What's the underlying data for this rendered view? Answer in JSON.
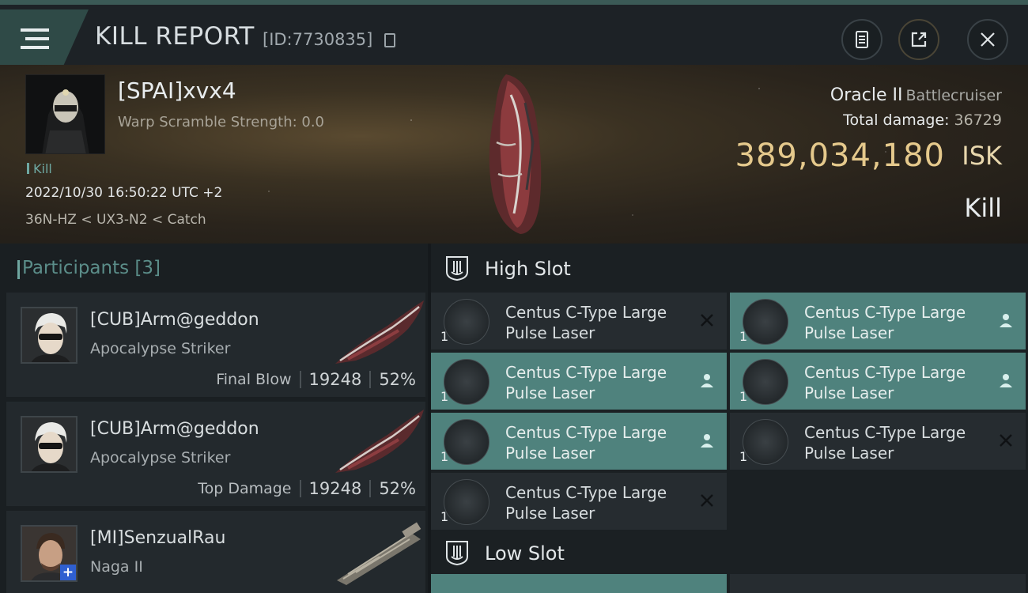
{
  "header": {
    "title": "KILL REPORT",
    "kill_id": "[ID:7730835]",
    "icons": {
      "menu": "hamburger-menu-icon",
      "copy": "copy-icon",
      "clipboard": "clipboard-icon",
      "share": "share-icon",
      "close": "close-icon"
    }
  },
  "victim": {
    "name": "[SPAI]xvx4",
    "warp_scramble": "Warp Scramble Strength: 0.0",
    "tag": "Kill",
    "datetime": "2022/10/30 16:50:22 UTC +2",
    "location": "36N-HZ < UX3-N2 < Catch",
    "ship_name": "Oracle II",
    "ship_class": "Battlecruiser",
    "total_damage_label": "Total damage:",
    "total_damage": "36729",
    "isk_value": "389,034,180",
    "isk_unit": "ISK",
    "status": "Kill"
  },
  "participants": {
    "label": "Participants",
    "count": "[3]",
    "list": [
      {
        "name": "[CUB]Arm@geddon",
        "ship": "Apocalypse Striker",
        "role": "Final Blow",
        "damage": "19248",
        "percent": "52%"
      },
      {
        "name": "[CUB]Arm@geddon",
        "ship": "Apocalypse Striker",
        "role": "Top Damage",
        "damage": "19248",
        "percent": "52%"
      },
      {
        "name": "[MI]SenzualRau",
        "ship": "Naga II",
        "badge": "+"
      }
    ]
  },
  "fitting": {
    "high_slot_label": "High Slot",
    "low_slot_label": "Low Slot",
    "high_slot": [
      {
        "name": "Centus C-Type Large Pulse Laser",
        "qty": "1",
        "status": "destroyed-x-icon",
        "fitted": false
      },
      {
        "name": "Centus C-Type Large Pulse Laser",
        "qty": "1",
        "status": "dropped-person-icon",
        "fitted": true
      },
      {
        "name": "Centus C-Type Large Pulse Laser",
        "qty": "1",
        "status": "dropped-person-icon",
        "fitted": true
      },
      {
        "name": "Centus C-Type Large Pulse Laser",
        "qty": "1",
        "status": "dropped-person-icon",
        "fitted": true
      },
      {
        "name": "Centus C-Type Large Pulse Laser",
        "qty": "1",
        "status": "dropped-person-icon",
        "fitted": true
      },
      {
        "name": "Centus C-Type Large Pulse Laser",
        "qty": "1",
        "status": "destroyed-x-icon",
        "fitted": false
      },
      {
        "name": "Centus C-Type Large Pulse Laser",
        "qty": "1",
        "status": "destroyed-x-icon",
        "fitted": false
      }
    ]
  },
  "colors": {
    "accent_teal": "#4f827d",
    "isk_gold": "#e5c98c",
    "participants_title": "#5b8d89"
  }
}
